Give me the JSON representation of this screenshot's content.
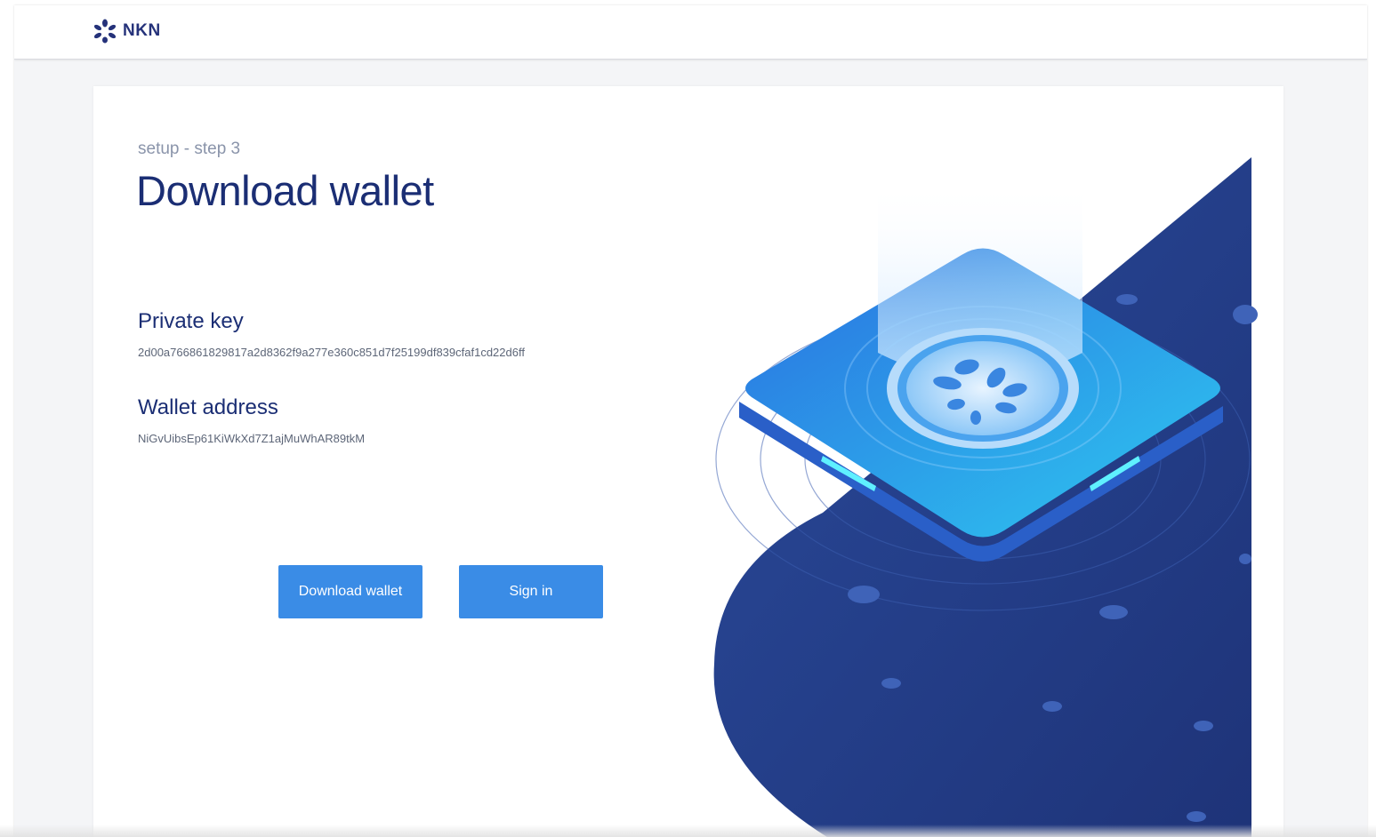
{
  "app": {
    "brand_name": "NKN",
    "brand_icon": "nkn-logo-icon"
  },
  "page": {
    "step_label": "setup - step 3",
    "title": "Download wallet"
  },
  "fields": {
    "private_key": {
      "label": "Private key",
      "value": "2d00a766861829817a2d8362f9a277e360c851d7f25199df839cfaf1cd22d6ff"
    },
    "wallet_address": {
      "label": "Wallet address",
      "value": "NiGvUibsEp61KiWkXd7Z1ajMuWhAR89tkM"
    }
  },
  "actions": {
    "download_label": "Download wallet",
    "signin_label": "Sign in"
  },
  "colors": {
    "accent": "#3a8ce6",
    "title": "#1b2e74",
    "illustration_dark": "#23357e"
  }
}
